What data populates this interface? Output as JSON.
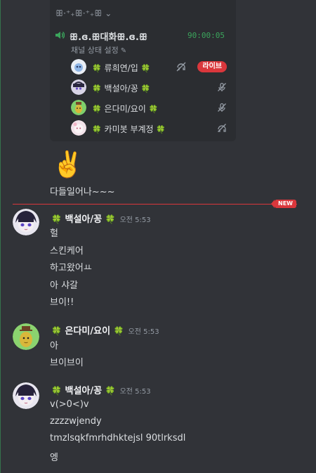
{
  "voice": {
    "header": "ꕥ·⁺₊ꕥ·⁺₊ꕥ ⌄",
    "channel": "ꕥ.ɞ.ꕥ대화ꕥ.ɞ.ꕥ",
    "timer": "90:00:05",
    "status_label": "채널 상태 설정",
    "members": [
      {
        "name": "류희연/입",
        "live": true,
        "icon": "deafen-icon"
      },
      {
        "name": "백설아/꽁",
        "live": false,
        "icon": "mute-icon"
      },
      {
        "name": "은다미/요이",
        "live": false,
        "icon": "mute-icon"
      },
      {
        "name": "카미봇 부계정",
        "live": false,
        "icon": "headphones-off-icon"
      }
    ],
    "live_label": "라이브"
  },
  "clover": "🍀",
  "emoji_message": "✌️",
  "plain_message": "다들일어나~~~",
  "new_label": "NEW",
  "messages": [
    {
      "author": "백설아/꽁",
      "time": "오전 5:53",
      "lines": [
        "헐",
        "스킨케어",
        "하고왔어ㅛ",
        "아 샤갈",
        "브이!!"
      ]
    },
    {
      "author": "은다미/요이",
      "time": "오전 5:53",
      "lines": [
        "아",
        "브이브이"
      ]
    },
    {
      "author": "백설아/꽁",
      "time": "오전 5:53",
      "lines": [
        "v(>0<)v",
        "zzzzwjendy",
        "tmzlsqkfmrhdhktejsl 90tlrksdl",
        "엥"
      ]
    }
  ],
  "colors": {
    "accent_green": "#3ba55c",
    "live_red": "#da373c",
    "background": "#313338"
  }
}
